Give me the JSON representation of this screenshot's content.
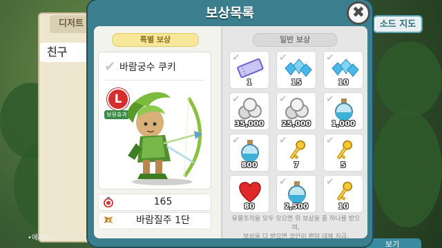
{
  "modal": {
    "title": "보상목록",
    "close_icon": "✖"
  },
  "tabs": {
    "special": "특별 보상",
    "normal": "일반 보상"
  },
  "special_reward": {
    "name": "바람궁수 쿠키",
    "badge": "L",
    "tag": "보유효과"
  },
  "stats": {
    "row1_value": "165",
    "row2_value": "바람질주 1단"
  },
  "rewards": [
    {
      "icon": "ticket-icon",
      "qty": "1"
    },
    {
      "icon": "crystals-icon",
      "qty": "15"
    },
    {
      "icon": "crystals-icon",
      "qty": "10"
    },
    {
      "icon": "coins-icon",
      "qty": "35,000"
    },
    {
      "icon": "coins-icon",
      "qty": "25,000"
    },
    {
      "icon": "potion-icon",
      "qty": "1,000"
    },
    {
      "icon": "potion-icon",
      "qty": "800"
    },
    {
      "icon": "key-icon",
      "qty": "7"
    },
    {
      "icon": "key-icon",
      "qty": "5"
    },
    {
      "icon": "heart-icon",
      "qty": "80"
    },
    {
      "icon": "potion-icon",
      "qty": "2,500"
    },
    {
      "icon": "key-icon",
      "qty": "10"
    }
  ],
  "footer": {
    "line1": "유물조각을 모두 모으면 위 보상을 중 하나를 받으며,",
    "line2": "보상을 다 받으면 코인이 랜덤 대체 지급."
  },
  "background": {
    "left_tab": "디저트",
    "left_name": "친구",
    "right_tab": "소드 지도",
    "left_foot": "•에피소드",
    "right_button": "보기"
  },
  "colors": {
    "modal": "#3b7f8e",
    "special_pill": "#f6e79b",
    "l_badge": "#d72d2d"
  }
}
